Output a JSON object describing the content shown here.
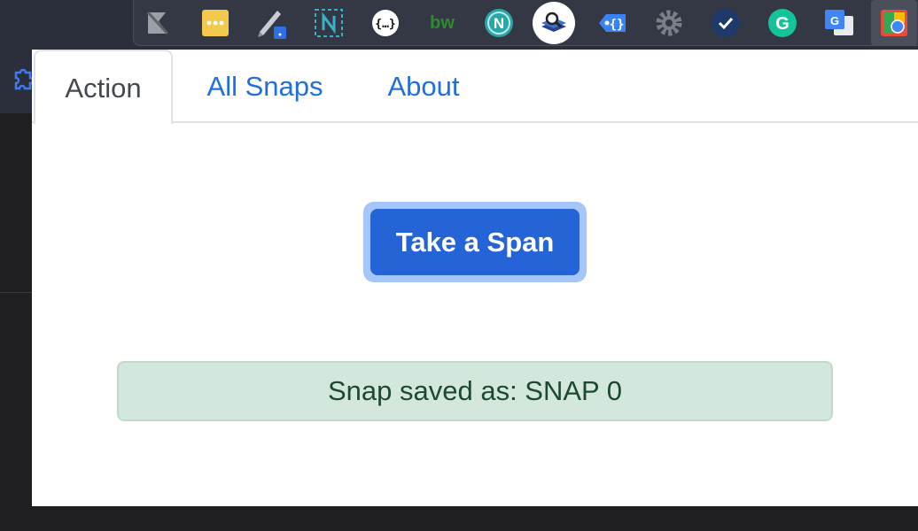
{
  "browser": {
    "extensions": [
      {
        "name": "bookmark-extension-icon"
      },
      {
        "name": "dots-extension-icon"
      },
      {
        "name": "pen-extension-icon"
      },
      {
        "name": "n-frame-extension-icon"
      },
      {
        "name": "json-braces-extension-icon"
      },
      {
        "name": "bw-extension-icon",
        "label": "bw"
      },
      {
        "name": "n-circle-extension-icon",
        "label": "N"
      },
      {
        "name": "search-layers-extension-icon"
      },
      {
        "name": "tag-extension-icon"
      },
      {
        "name": "gear-extension-icon"
      },
      {
        "name": "check-extension-icon"
      },
      {
        "name": "grammarly-extension-icon",
        "label": "G"
      },
      {
        "name": "translate-extension-icon",
        "label": "G"
      },
      {
        "name": "active-extension-icon"
      }
    ]
  },
  "popup": {
    "tabs": [
      {
        "label": "Action",
        "active": true
      },
      {
        "label": "All Snaps",
        "active": false
      },
      {
        "label": "About",
        "active": false
      }
    ],
    "action_button_label": "Take a Span",
    "status_message": "Snap saved as: SNAP 0"
  },
  "colors": {
    "accent": "#2464d6",
    "link": "#1f6fe0",
    "success_bg": "#d4e7dd",
    "success_text": "#1b4a2e"
  }
}
